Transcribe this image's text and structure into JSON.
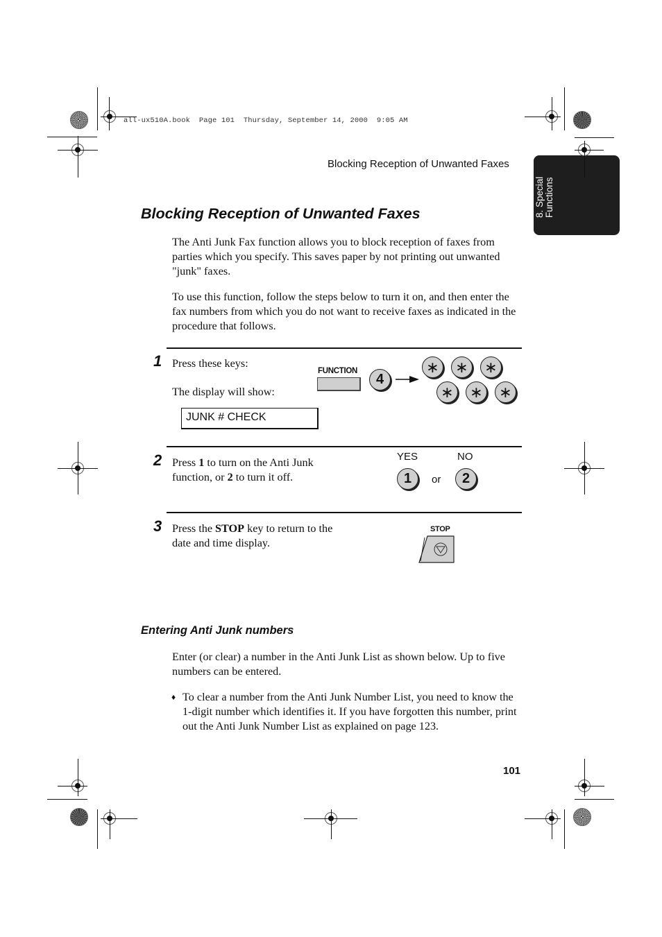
{
  "print_slug": "all-ux510A.book  Page 101  Thursday, September 14, 2000  9:05 AM",
  "running_head": "Blocking Reception of Unwanted Faxes",
  "chapter_tab": {
    "line1": "8. Special",
    "line2": "Functions"
  },
  "section_title": "Blocking Reception of Unwanted Faxes",
  "intro_paragraphs": [
    "The Anti Junk Fax function allows you to block reception of faxes from parties which you specify. This saves paper by not printing out unwanted \"junk\" faxes.",
    "To use this function, follow the steps below to turn it on, and then enter the fax numbers from which you do not want to receive faxes as indicated in the procedure that follows."
  ],
  "steps": [
    {
      "number": "1",
      "text_line1": "Press these keys:",
      "text_line2": "The display will show:",
      "display": "JUNK # CHECK",
      "keys": {
        "function_label": "FUNCTION",
        "digit": "4",
        "star": "∗",
        "star_count": 6
      }
    },
    {
      "number": "2",
      "pre1": "Press ",
      "bold1": "1",
      "mid1": " to turn on the Anti Junk",
      "pre2": "function, or ",
      "bold2": "2",
      "post2": " to turn it off.",
      "yes_label": "YES",
      "no_label": "NO",
      "yes_key": "1",
      "no_key": "2",
      "or_label": "or"
    },
    {
      "number": "3",
      "pre1": "Press the ",
      "bold1": "STOP",
      "post1": " key to return to the",
      "line2": "date and time display.",
      "stop_label": "STOP"
    }
  ],
  "subsection_title": "Entering Anti Junk numbers",
  "subsection_paragraph": "Enter (or clear) a number in the Anti Junk List as shown below. Up to five numbers can be entered.",
  "bullet": {
    "glyph": "♦",
    "text": "To clear a number from the Anti Junk Number List, you need to know the 1-digit number which identifies it. If you have forgotten this number, print out the Anti Junk Number List as explained on page 123."
  },
  "page_number": "101"
}
